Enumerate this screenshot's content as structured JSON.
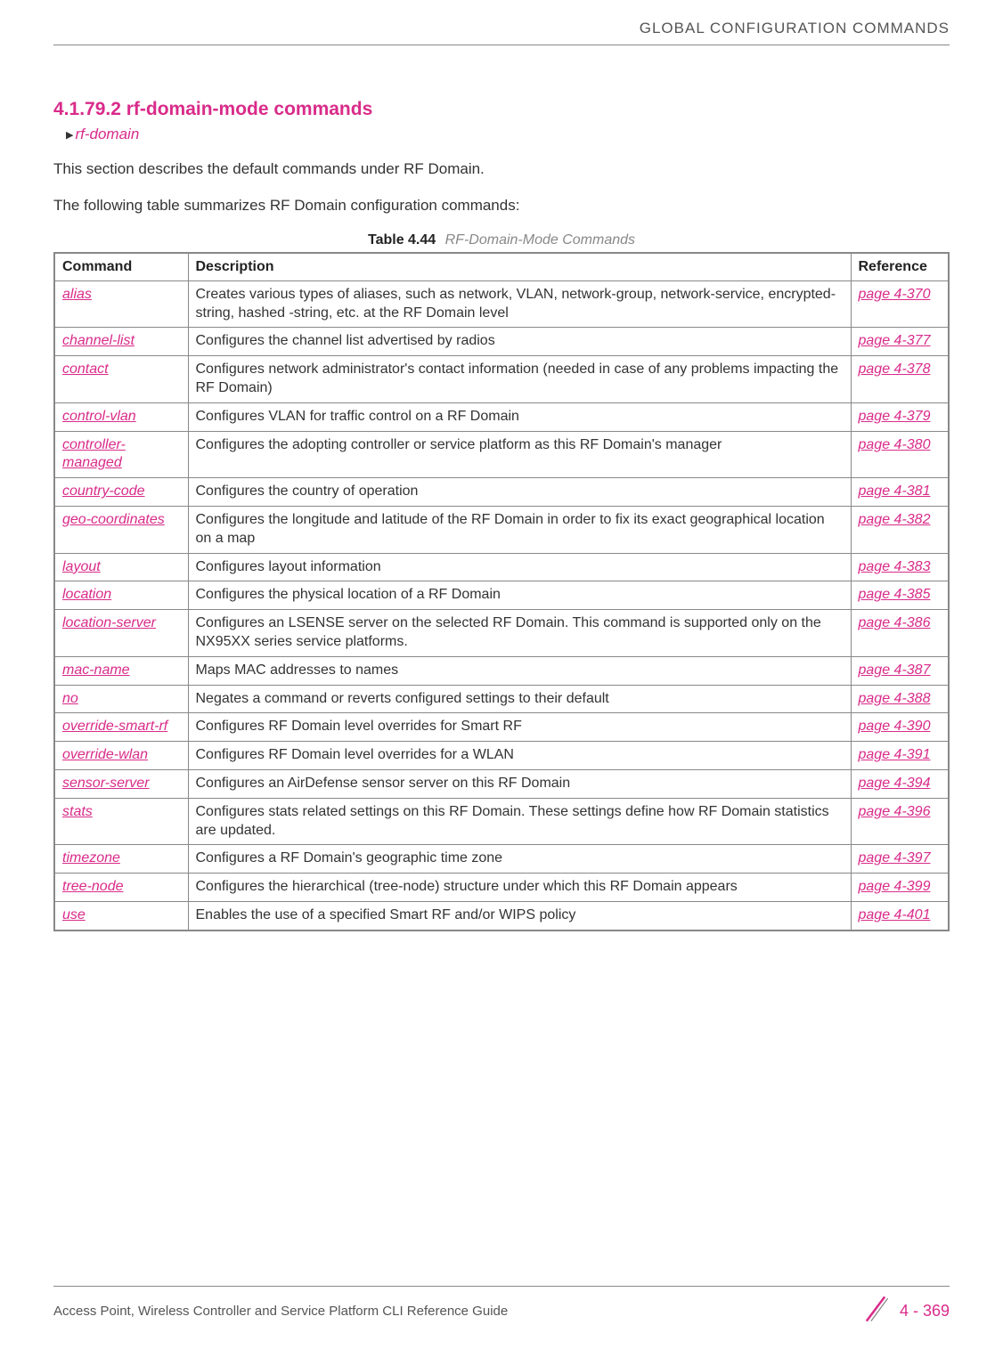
{
  "header": {
    "running_title": "GLOBAL CONFIGURATION COMMANDS"
  },
  "section": {
    "heading": "4.1.79.2 rf-domain-mode commands",
    "breadcrumb": "rf-domain",
    "intro1": "This section describes the default commands under RF Domain.",
    "intro2": "The following table summarizes RF Domain configuration commands:"
  },
  "table": {
    "caption_label": "Table 4.44",
    "caption_title": "RF-Domain-Mode Commands",
    "headers": {
      "command": "Command",
      "description": "Description",
      "reference": "Reference"
    },
    "rows": [
      {
        "command": "alias",
        "description": "Creates various types of aliases, such as network, VLAN, network-group, network-service, encrypted-string, hashed -string, etc. at the RF Domain level",
        "reference": "page 4-370"
      },
      {
        "command": "channel-list",
        "description": "Configures the channel list advertised by radios",
        "reference": "page 4-377"
      },
      {
        "command": "contact",
        "description": "Configures network administrator's contact information (needed in case of any problems impacting the RF Domain)",
        "reference": "page 4-378"
      },
      {
        "command": "control-vlan",
        "description": "Configures VLAN for traffic control on a RF Domain",
        "reference": "page 4-379"
      },
      {
        "command": "controller-managed",
        "description": "Configures the adopting controller or service platform as this RF Domain's manager",
        "reference": "page 4-380"
      },
      {
        "command": "country-code",
        "description": "Configures the country of operation",
        "reference": "page 4-381"
      },
      {
        "command": "geo-coordinates",
        "description": "Configures the longitude and latitude of the RF Domain in order to fix its exact geographical location on a map",
        "reference": "page 4-382"
      },
      {
        "command": "layout",
        "description": "Configures layout information",
        "reference": "page 4-383"
      },
      {
        "command": "location",
        "description": "Configures the physical location of a RF Domain",
        "reference": "page 4-385"
      },
      {
        "command": "location-server",
        "description": "Configures an LSENSE server on the selected RF Domain. This command is supported only on the NX95XX series service platforms.",
        "reference": "page 4-386"
      },
      {
        "command": "mac-name",
        "description": "Maps MAC addresses to names",
        "reference": "page 4-387"
      },
      {
        "command": "no",
        "description": "Negates a command or reverts configured settings to their default",
        "reference": "page 4-388"
      },
      {
        "command": "override-smart-rf",
        "description": "Configures RF Domain level overrides for Smart RF",
        "reference": "page 4-390"
      },
      {
        "command": "override-wlan",
        "description": "Configures RF Domain level overrides for a WLAN",
        "reference": "page 4-391"
      },
      {
        "command": "sensor-server",
        "description": "Configures an AirDefense sensor server on this RF Domain",
        "reference": "page 4-394"
      },
      {
        "command": "stats",
        "description": "Configures stats related settings on this RF Domain. These settings define how RF Domain statistics are updated.",
        "reference": "page 4-396"
      },
      {
        "command": "timezone",
        "description": "Configures a RF Domain's geographic time zone",
        "reference": "page 4-397"
      },
      {
        "command": "tree-node",
        "description": "Configures the hierarchical (tree-node) structure under which this RF Domain appears",
        "reference": "page 4-399"
      },
      {
        "command": "use",
        "description": "Enables the use of a specified Smart RF and/or WIPS policy",
        "reference": "page 4-401"
      }
    ]
  },
  "footer": {
    "guide_title": "Access Point, Wireless Controller and Service Platform CLI Reference Guide",
    "page_number": "4 - 369"
  }
}
